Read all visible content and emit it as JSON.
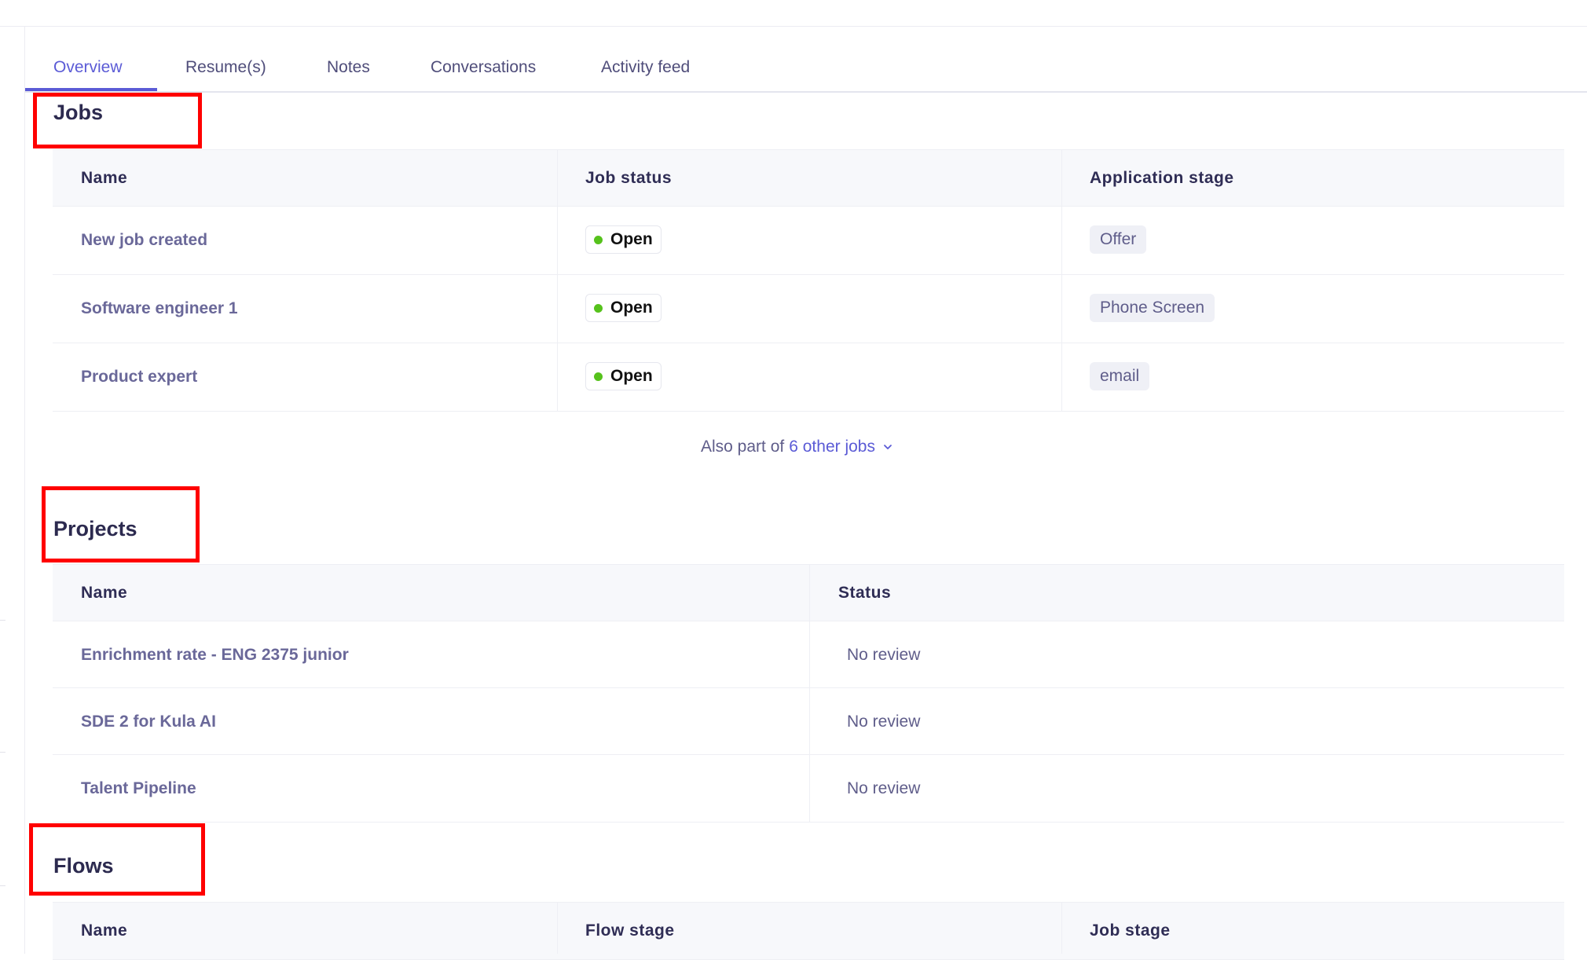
{
  "tabs": [
    {
      "label": "Overview",
      "active": true
    },
    {
      "label": "Resume(s)"
    },
    {
      "label": "Notes"
    },
    {
      "label": "Conversations"
    },
    {
      "label": "Activity feed"
    }
  ],
  "jobs": {
    "title": "Jobs",
    "columns": [
      "Name",
      "Job status",
      "Application stage"
    ],
    "rows": [
      {
        "name": "New job created",
        "status": "Open",
        "stage": "Offer"
      },
      {
        "name": "Software engineer 1",
        "status": "Open",
        "stage": "Phone Screen"
      },
      {
        "name": "Product expert",
        "status": "Open",
        "stage": "email"
      }
    ],
    "also_prefix": "Also part of",
    "also_link": "6 other jobs"
  },
  "projects": {
    "title": "Projects",
    "columns": [
      "Name",
      "Status"
    ],
    "rows": [
      {
        "name": "Enrichment rate - ENG 2375 junior",
        "status": "No review"
      },
      {
        "name": "SDE 2 for Kula AI",
        "status": "No review"
      },
      {
        "name": "Talent Pipeline",
        "status": "No review"
      }
    ]
  },
  "flows": {
    "title": "Flows",
    "columns": [
      "Name",
      "Flow stage",
      "Job stage"
    ]
  },
  "colors": {
    "accent": "#5b5bd6",
    "open_dot": "#56c21c",
    "highlight_box": "#ff0000"
  }
}
